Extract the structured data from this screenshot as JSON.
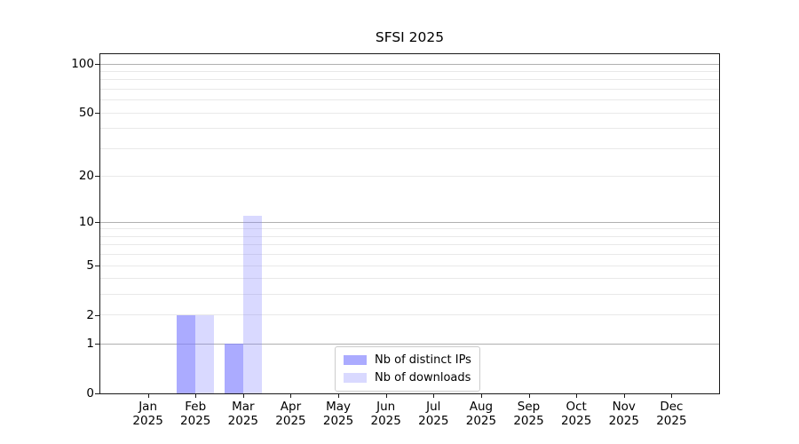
{
  "chart_data": {
    "type": "bar",
    "title": "SFSI 2025",
    "categories": [
      "Jan",
      "Feb",
      "Mar",
      "Apr",
      "May",
      "Jun",
      "Jul",
      "Aug",
      "Sep",
      "Oct",
      "Nov",
      "Dec"
    ],
    "x_year_label": "2025",
    "series": [
      {
        "name": "Nb of distinct IPs",
        "color": "rgba(128,128,255,0.66)",
        "values": [
          0,
          2,
          1,
          0,
          0,
          0,
          0,
          0,
          0,
          0,
          0,
          0
        ]
      },
      {
        "name": "Nb of downloads",
        "color": "rgba(128,128,255,0.30)",
        "values": [
          0,
          2,
          11,
          0,
          0,
          0,
          0,
          0,
          0,
          0,
          0,
          0
        ]
      }
    ],
    "y_axis": {
      "scale": "log1p",
      "ticks": [
        0,
        1,
        2,
        5,
        10,
        20,
        50,
        100
      ],
      "major_gridlines": [
        1,
        10,
        100
      ],
      "minor_gridlines": [
        2,
        3,
        4,
        5,
        6,
        7,
        8,
        9,
        20,
        30,
        40,
        50,
        60,
        70,
        80,
        90
      ],
      "ylim": [
        0,
        115
      ]
    },
    "legend_position": "lower center",
    "grid": true,
    "colors": {
      "major_grid": "#b0b0b0",
      "minor_grid": "#e9e9e9",
      "spine": "#1a1a1a",
      "background": "#ffffff"
    }
  }
}
